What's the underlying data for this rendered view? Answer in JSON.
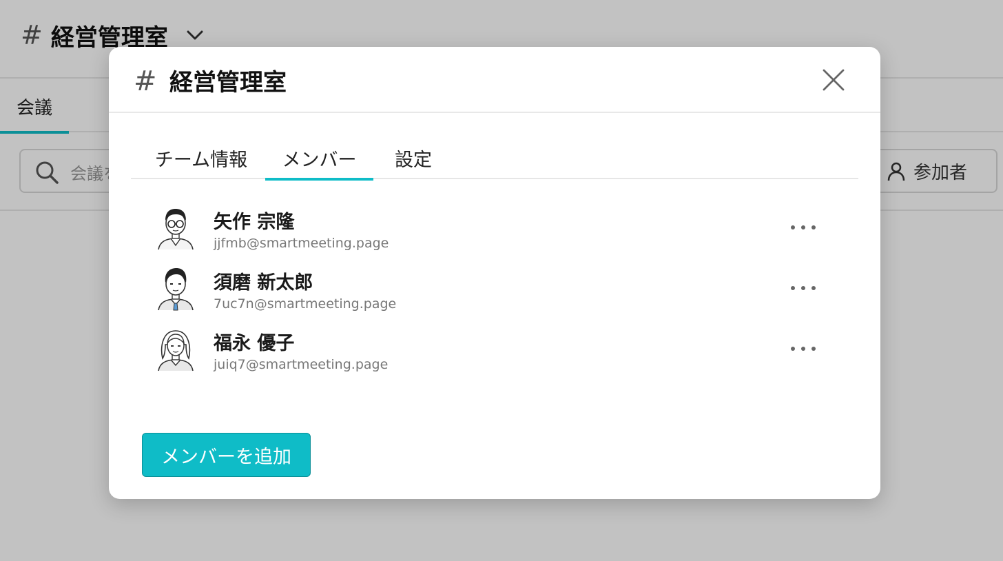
{
  "app": {
    "channel_hash": "#",
    "channel_name": "経営管理室",
    "tab_meetings": "会議",
    "search_placeholder": "会議を",
    "participants_label": "参加者"
  },
  "modal": {
    "hash": "#",
    "title": "経営管理室",
    "tabs": [
      {
        "label": "チーム情報",
        "active": false
      },
      {
        "label": "メンバー",
        "active": true
      },
      {
        "label": "設定",
        "active": false
      }
    ],
    "members": [
      {
        "name": "矢作 宗隆",
        "email": "jjfmb@smartmeeting.page",
        "avatar": "man-glasses-avatar"
      },
      {
        "name": "須磨 新太郎",
        "email": "7uc7n@smartmeeting.page",
        "avatar": "man-tie-avatar"
      },
      {
        "name": "福永 優子",
        "email": "juiq7@smartmeeting.page",
        "avatar": "woman-avatar"
      }
    ],
    "add_button": "メンバーを追加"
  },
  "colors": {
    "accent": "#0fbcc7",
    "overlay": "rgba(0,0,0,0.24)"
  }
}
